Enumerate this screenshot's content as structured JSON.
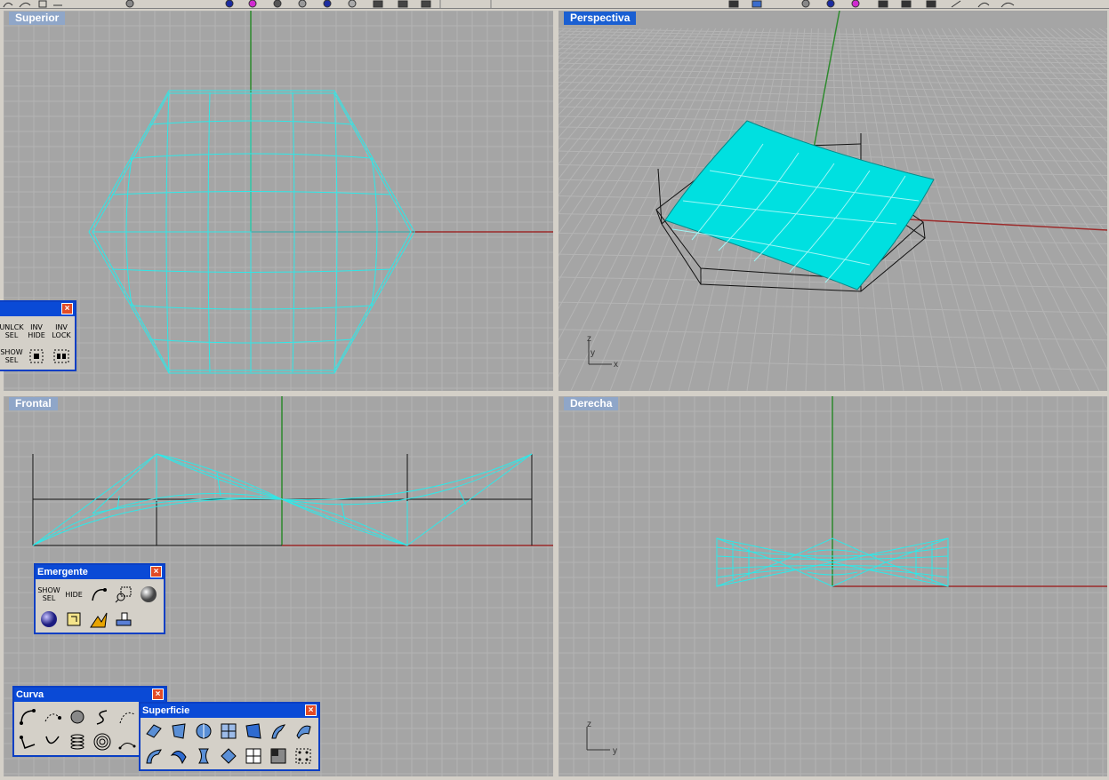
{
  "viewports": {
    "top": {
      "label": "Superior"
    },
    "perspective": {
      "label": "Perspectiva"
    },
    "front": {
      "label": "Frontal"
    },
    "right": {
      "label": "Derecha"
    }
  },
  "axes": {
    "perspective": {
      "z": "z",
      "y": "y",
      "x": "x"
    },
    "right": {
      "z": "z",
      "y": "y"
    }
  },
  "palettes": {
    "visibility": {
      "title": "",
      "buttons": [
        {
          "line1": "UNLCK",
          "line2": "SEL"
        },
        {
          "line1": "INV",
          "line2": "HIDE"
        },
        {
          "line1": "INV",
          "line2": "LOCK"
        },
        {
          "line1": "SHOW",
          "line2": "SEL"
        }
      ]
    },
    "emergente": {
      "title": "Emergente",
      "show_sel_1": "SHOW",
      "show_sel_2": "SEL",
      "hide": "HIDE"
    },
    "curva": {
      "title": "Curva"
    },
    "superficie": {
      "title": "Superficie"
    }
  },
  "colors": {
    "viewport_bg": "#a5a5a5",
    "grid": "#b4b4b4",
    "wire": "#2ee8e8",
    "surface": "#00e0e0",
    "x_axis": "#9c2b2b",
    "y_axis": "#2d8a2d",
    "title_active": "#1a5fd2",
    "title_inactive": "#8fa6c8"
  },
  "icons": [
    "zoom-icon",
    "rotate-icon",
    "sphere-icon",
    "color-wheel-icon",
    "grid-icon",
    "close-icon",
    "curve-icon",
    "point-icon",
    "spiral-icon",
    "surface-icon"
  ]
}
